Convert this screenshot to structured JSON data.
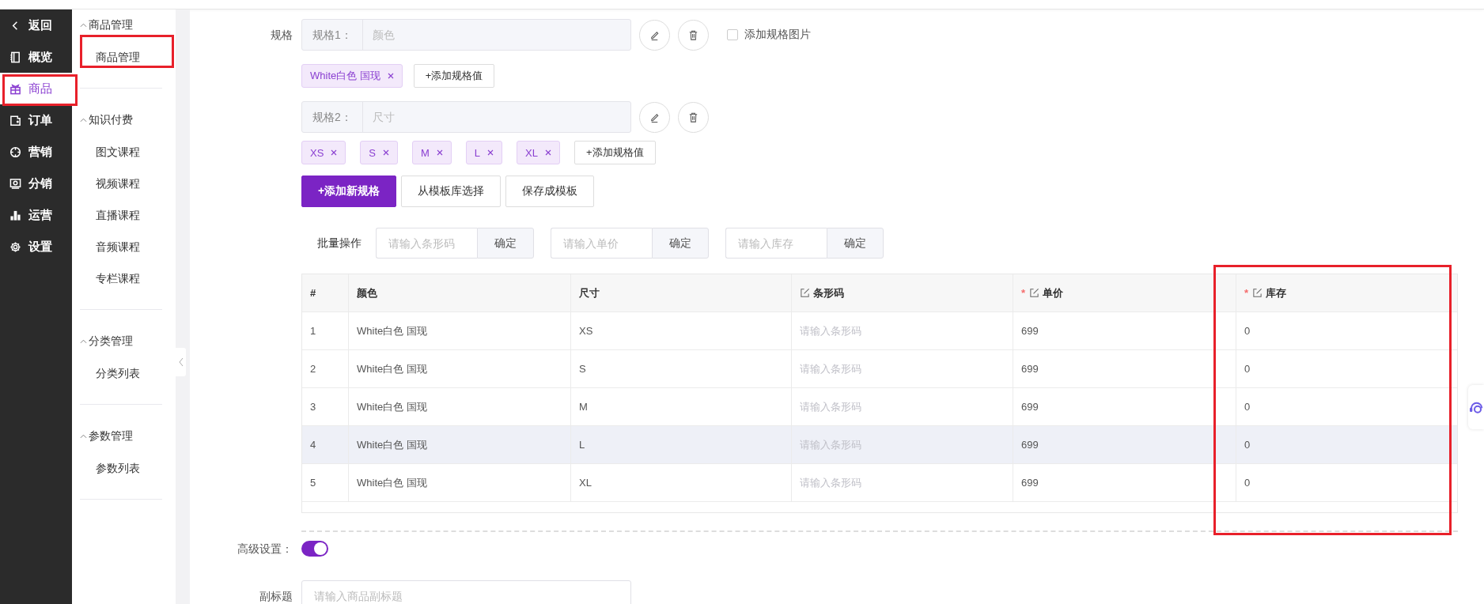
{
  "nav": {
    "items": [
      {
        "label": "返回",
        "selected": false,
        "highlighted": false
      },
      {
        "label": "概览",
        "selected": false,
        "highlighted": false
      },
      {
        "label": "商品",
        "selected": true,
        "highlighted": true
      },
      {
        "label": "订单",
        "selected": false,
        "highlighted": false
      },
      {
        "label": "营销",
        "selected": false,
        "highlighted": false
      },
      {
        "label": "分销",
        "selected": false,
        "highlighted": false
      },
      {
        "label": "运营",
        "selected": false,
        "highlighted": false
      },
      {
        "label": "设置",
        "selected": false,
        "highlighted": false
      }
    ]
  },
  "subnav": {
    "groups": [
      {
        "title": "商品管理",
        "expanded": true,
        "items": [
          {
            "label": "商品管理",
            "highlighted": true
          }
        ]
      },
      {
        "title": "知识付费",
        "expanded": true,
        "items": [
          {
            "label": "图文课程",
            "highlighted": false
          },
          {
            "label": "视频课程",
            "highlighted": false
          },
          {
            "label": "直播课程",
            "highlighted": false
          },
          {
            "label": "音频课程",
            "highlighted": false
          },
          {
            "label": "专栏课程",
            "highlighted": false
          }
        ]
      },
      {
        "title": "分类管理",
        "expanded": true,
        "items": [
          {
            "label": "分类列表",
            "highlighted": false
          }
        ]
      },
      {
        "title": "参数管理",
        "expanded": true,
        "items": [
          {
            "label": "参数列表",
            "highlighted": false
          }
        ]
      }
    ]
  },
  "form": {
    "spec_label": "规格",
    "specs": [
      {
        "label": "规格1：",
        "value": "颜色",
        "values": [
          "White白色 国现"
        ],
        "add_value": "+添加规格值"
      },
      {
        "label": "规格2：",
        "value": "尺寸",
        "values": [
          "XS",
          "S",
          "M",
          "L",
          "XL"
        ],
        "add_value": "+添加规格值"
      }
    ],
    "spec_image": {
      "label": "添加规格图片",
      "checked": false
    },
    "buttons": [
      {
        "label": "+添加新规格",
        "kind": "primary"
      },
      {
        "label": "从模板库选择",
        "kind": "default"
      },
      {
        "label": "保存成模板",
        "kind": "default"
      }
    ],
    "batch": {
      "label": "批量操作",
      "fields": [
        {
          "placeholder": "请输入条形码",
          "button": "确定"
        },
        {
          "placeholder": "请输入单价",
          "button": "确定"
        },
        {
          "placeholder": "请输入库存",
          "button": "确定"
        }
      ]
    },
    "table": {
      "columns": [
        {
          "label": "#",
          "editable": false,
          "highlighted": false
        },
        {
          "label": "颜色",
          "editable": false,
          "highlighted": false
        },
        {
          "label": "尺寸",
          "editable": false,
          "highlighted": false
        },
        {
          "label": "条形码",
          "editable": true,
          "highlighted": false
        },
        {
          "label": "单价",
          "required_mark": "*",
          "editable": true,
          "highlighted": false
        },
        {
          "label": "库存",
          "required_mark": "*",
          "editable": true,
          "highlighted": true
        }
      ],
      "rows": [
        {
          "index": "1",
          "spec_1": "White白色 国现",
          "spec_2": "XS",
          "barcode_placeholder": "请输入条形码",
          "price": "699",
          "stock": "0",
          "hovered": false
        },
        {
          "index": "2",
          "spec_1": "White白色 国现",
          "spec_2": "S",
          "barcode_placeholder": "请输入条形码",
          "price": "699",
          "stock": "0",
          "hovered": false
        },
        {
          "index": "3",
          "spec_1": "White白色 国现",
          "spec_2": "M",
          "barcode_placeholder": "请输入条形码",
          "price": "699",
          "stock": "0",
          "hovered": false
        },
        {
          "index": "4",
          "spec_1": "White白色 国现",
          "spec_2": "L",
          "barcode_placeholder": "请输入条形码",
          "price": "699",
          "stock": "0",
          "hovered": true
        },
        {
          "index": "5",
          "spec_1": "White白色 国现",
          "spec_2": "XL",
          "barcode_placeholder": "请输入条形码",
          "price": "699",
          "stock": "0",
          "hovered": false
        }
      ]
    },
    "advanced": {
      "label": "高级设置：",
      "on": true
    },
    "subtitle": {
      "label": "副标题",
      "placeholder": "请输入商品副标题"
    }
  }
}
